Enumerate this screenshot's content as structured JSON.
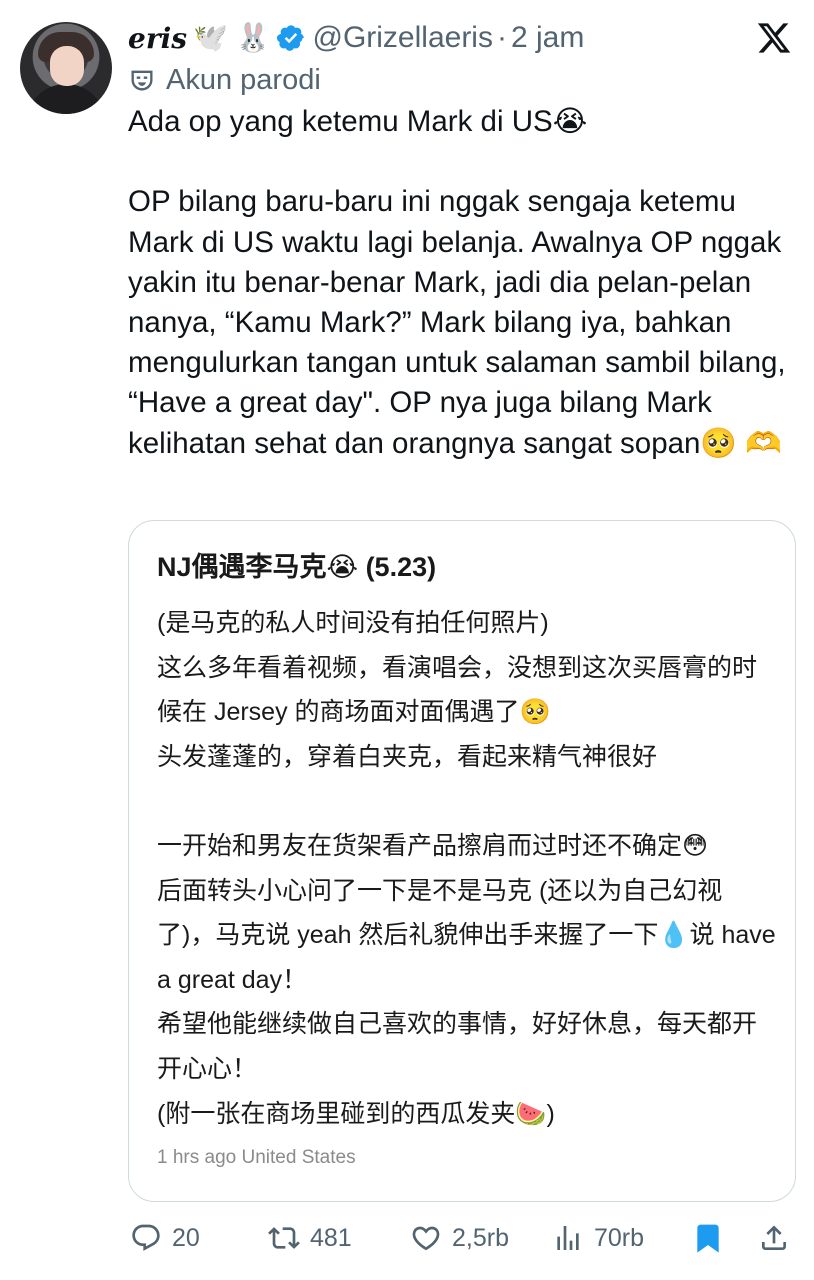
{
  "author": {
    "name": "eris",
    "name_emojis": "🕊️ 🐰",
    "handle": "@Grizellaeris",
    "separator": "·",
    "time": "2 jam",
    "parody_label": "Akun parodi"
  },
  "tweet": {
    "text": "Ada op yang ketemu Mark di US😭\n\nOP bilang baru-baru ini nggak sengaja ketemu Mark di US waktu lagi belanja. Awalnya OP nggak yakin itu benar-benar Mark, jadi dia pelan-pelan nanya, “Kamu Mark?” Mark bilang iya, bahkan mengulurkan tangan untuk salaman sambil bilang, “Have a great day\". OP nya juga bilang Mark kelihatan sehat dan orangnya sangat sopan🥺 🫶"
  },
  "quote": {
    "title": "NJ偶遇李马克😭 (5.23)",
    "body": "(是马克的私人时间没有拍任何照片)\n这么多年看着视频，看演唱会，没想到这次买唇膏的时候在 Jersey 的商场面对面偶遇了🥺\n头发蓬蓬的，穿着白夹克，看起来精气神很好\n\n一开始和男友在货架看产品擦肩而过时还不确定😳\n后面转头小心问了一下是不是马克 (还以为自己幻视了)，马克说 yeah 然后礼貌伸出手来握了一下💧说 have a great day！\n希望他能继续做自己喜欢的事情，好好休息，每天都开开心心！\n(附一张在商场里碰到的西瓜发夹🍉)",
    "meta": "1 hrs ago United States"
  },
  "actions": {
    "replies": "20",
    "reposts": "481",
    "likes": "2,5rb",
    "views": "70rb"
  },
  "colors": {
    "verified_blue": "#1d9bf0",
    "secondary_text": "#536471",
    "bookmark_blue": "#1d9bf0",
    "card_border": "#cfd9de"
  },
  "icons": [
    "x-logo-icon",
    "verified-badge-icon",
    "mask-icon",
    "reply-icon",
    "repost-icon",
    "like-icon",
    "views-icon",
    "bookmark-icon",
    "share-icon"
  ]
}
